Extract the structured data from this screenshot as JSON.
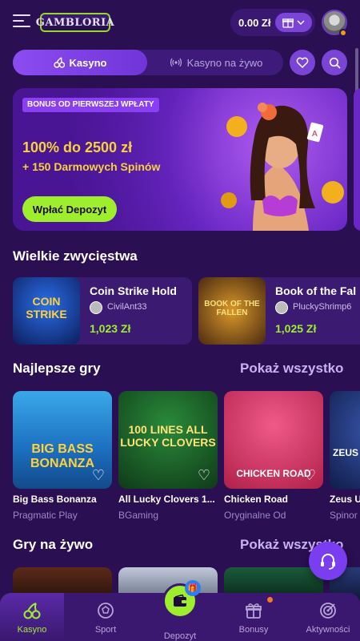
{
  "header": {
    "logo_text": "GAMBLORIA",
    "balance": "0.00 Zł",
    "avatar": "koala-avatar"
  },
  "tabs": {
    "casino": "Kasyno",
    "live_casino": "Kasyno na żywo"
  },
  "banner": {
    "tag": "BONUS OD PIERWSZEJ WPŁATY",
    "title": "100% do 2500 zł",
    "subtitle": "+ 150 Darmowych Spinów",
    "cta": "Wpłać Depozyt"
  },
  "big_wins": {
    "title": "Wielkie zwycięstwa",
    "items": [
      {
        "game": "Coin Strike Hold",
        "user": "CivilAnt33",
        "amount": "1,023 Zł",
        "thumb_text": "COIN STRIKE"
      },
      {
        "game": "Book of the Fal",
        "user": "PluckyShrimp6",
        "amount": "1,025 Zł",
        "thumb_text": "BOOK OF THE FALLEN"
      }
    ]
  },
  "top_games": {
    "title": "Najlepsze gry",
    "show_all": "Pokaż wszystko",
    "items": [
      {
        "name": "Big Bass Bonanza",
        "provider": "Pragmatic Play",
        "art": "BIG BASS BONANZA"
      },
      {
        "name": "All Lucky Clovers 1...",
        "provider": "BGaming",
        "art": "100 LINES ALL LUCKY CLOVERS"
      },
      {
        "name": "Chicken Road",
        "provider": "Oryginalne Od",
        "art": "CHICKEN ROAD"
      },
      {
        "name": "Zeus U",
        "provider": "Spinor",
        "art": "ZEUS"
      }
    ]
  },
  "live_games": {
    "title": "Gry na żywo",
    "show_all": "Pokaż wszystko"
  },
  "bottom_nav": {
    "casino": "Kasyno",
    "sport": "Sport",
    "deposit": "Depozyt",
    "bonuses": "Bonusy",
    "activity": "Aktywności"
  },
  "colors": {
    "background": "#2a0f52",
    "accent_green": "#9fee2d",
    "accent_purple": "#7a45d6",
    "banner_yellow": "#f7d23a"
  }
}
